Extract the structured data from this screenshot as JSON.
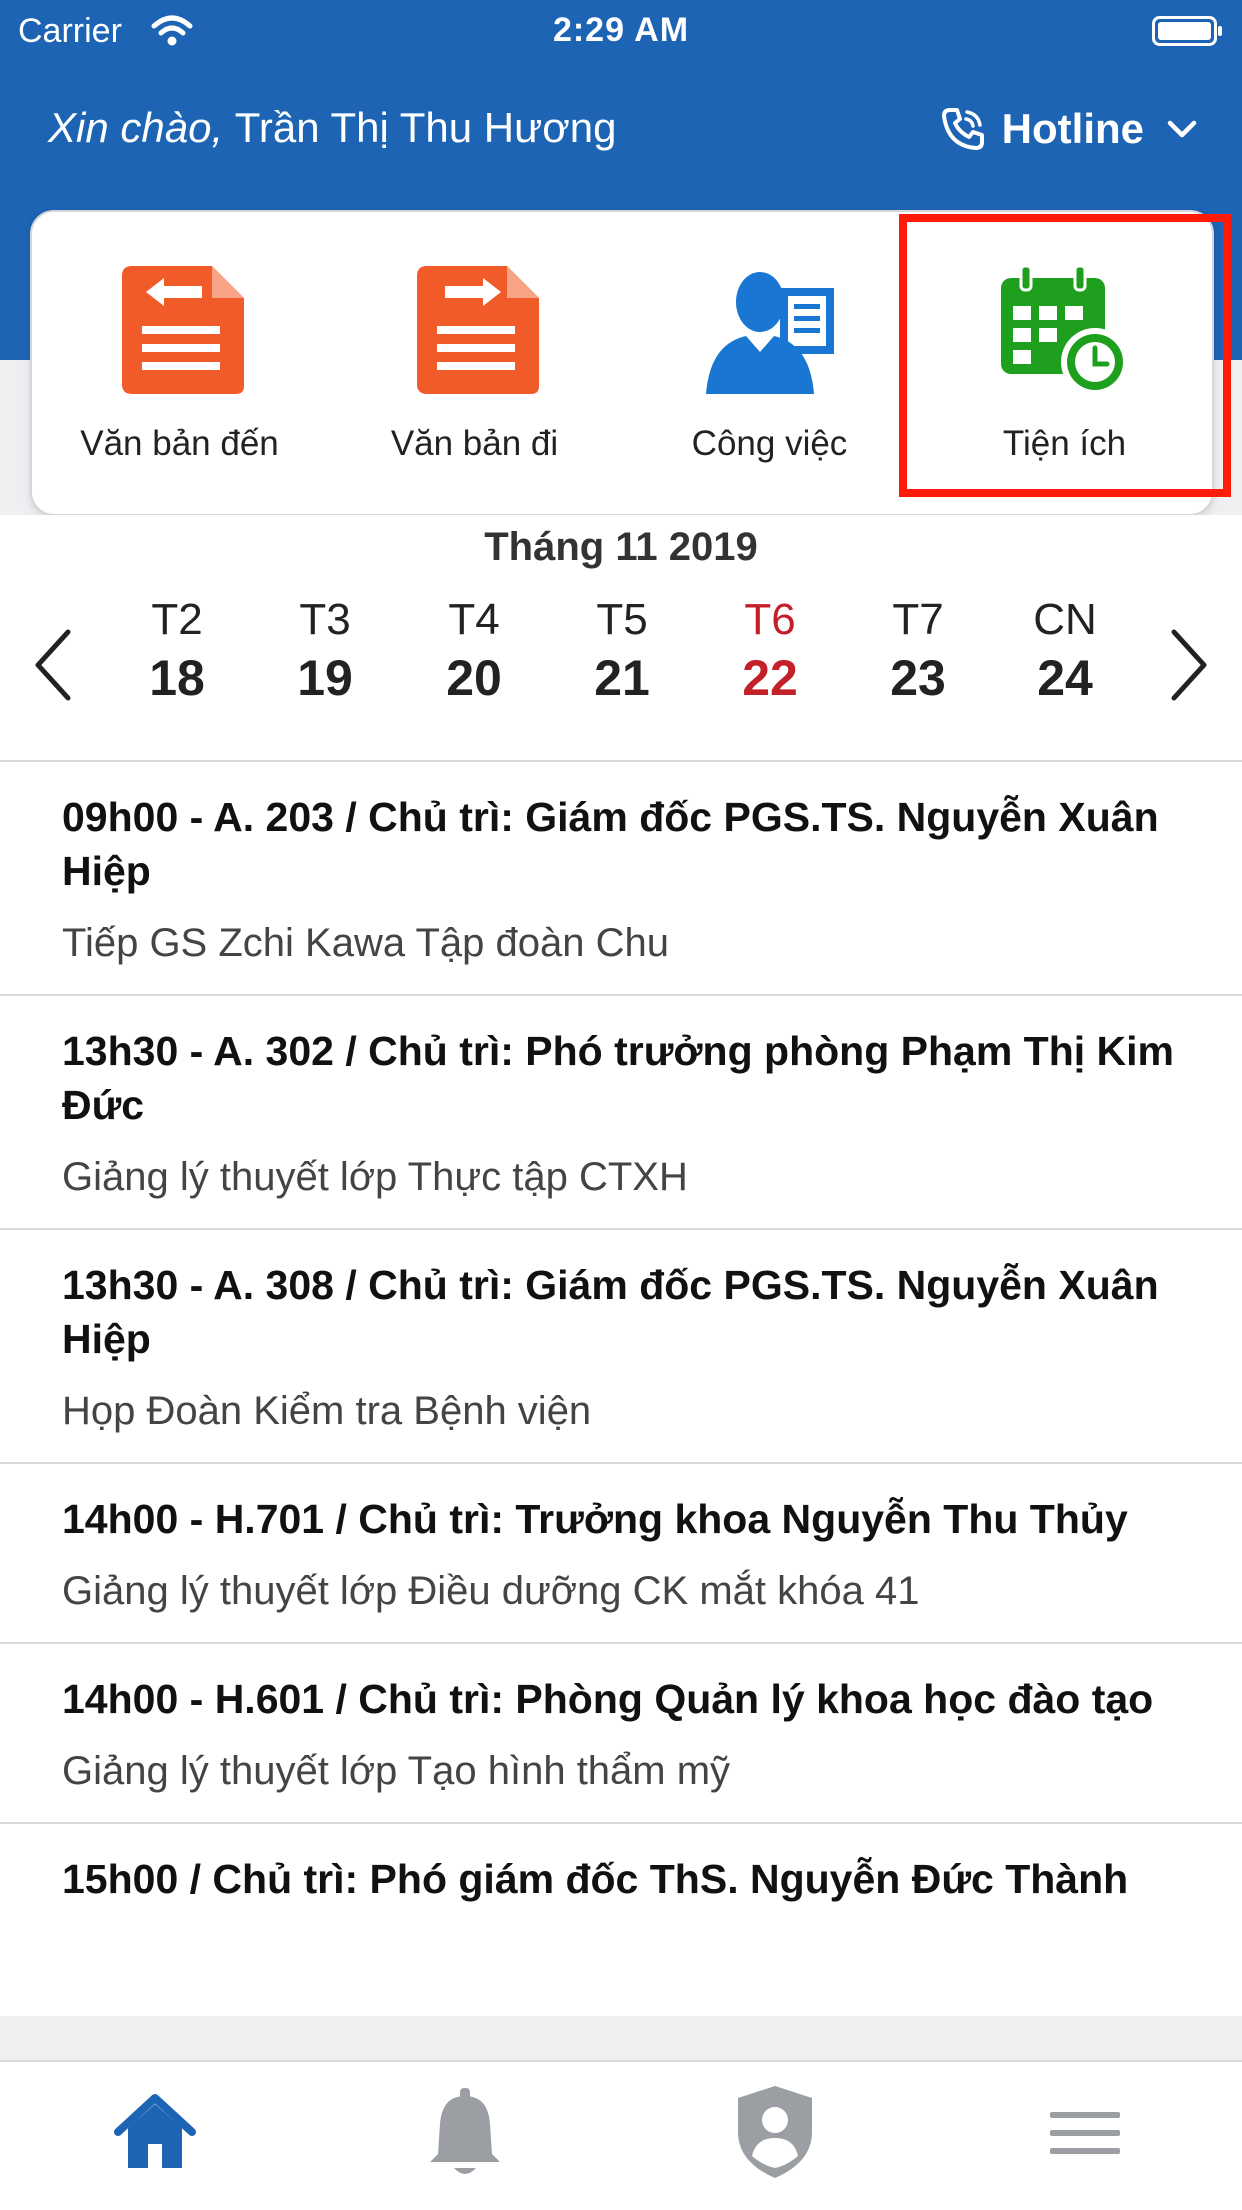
{
  "status_bar": {
    "carrier": "Carrier",
    "time": "2:29 AM"
  },
  "header": {
    "greeting_prefix": "Xin chào,",
    "user_name": "Trần Thị Thu Hương",
    "hotline_label": "Hotline"
  },
  "menu": [
    {
      "label": "Văn bản đến",
      "icon": "incoming-document-icon",
      "color": "#f15a29"
    },
    {
      "label": "Văn bản đi",
      "icon": "outgoing-document-icon",
      "color": "#f15a29"
    },
    {
      "label": "Công việc",
      "icon": "work-person-icon",
      "color": "#1976d2"
    },
    {
      "label": "Tiện ích",
      "icon": "calendar-clock-icon",
      "color": "#1ea01e"
    }
  ],
  "calendar": {
    "month_title": "Tháng 11 2019",
    "days": [
      {
        "name": "T2",
        "num": "18"
      },
      {
        "name": "T3",
        "num": "19"
      },
      {
        "name": "T4",
        "num": "20"
      },
      {
        "name": "T5",
        "num": "21"
      },
      {
        "name": "T6",
        "num": "22",
        "today": true
      },
      {
        "name": "T7",
        "num": "23"
      },
      {
        "name": "CN",
        "num": "24"
      }
    ]
  },
  "events": [
    {
      "title": "09h00 - A. 203 / Chủ trì: Giám đốc PGS.TS. Nguyễn Xuân Hiệp",
      "desc": "Tiếp GS Zchi Kawa Tập đoàn Chu"
    },
    {
      "title": "13h30 - A. 302 / Chủ trì: Phó trưởng phòng Phạm Thị Kim Đức",
      "desc": "Giảng lý thuyết lớp Thực tập CTXH"
    },
    {
      "title": "13h30 - A. 308 / Chủ trì: Giám đốc PGS.TS. Nguyễn Xuân Hiệp",
      "desc": "Họp Đoàn Kiểm tra Bệnh viện"
    },
    {
      "title": "14h00 - H.701 / Chủ trì: Trưởng khoa Nguyễn Thu Thủy",
      "desc": "Giảng lý thuyết lớp Điều dưỡng CK mắt khóa 41"
    },
    {
      "title": "14h00 - H.601 / Chủ trì: Phòng Quản lý khoa học đào tạo",
      "desc": "Giảng lý thuyết lớp Tạo hình thẩm mỹ"
    },
    {
      "title": "15h00 / Chủ trì: Phó giám đốc ThS. Nguyễn Đức Thành",
      "desc": ""
    }
  ],
  "tabbar": {
    "items": [
      {
        "icon": "home-icon",
        "active": true
      },
      {
        "icon": "bell-icon",
        "active": false
      },
      {
        "icon": "shield-user-icon",
        "active": false
      },
      {
        "icon": "menu-icon",
        "active": false
      }
    ],
    "active_color": "#1d64b4",
    "inactive_color": "#9b9ea3"
  },
  "colors": {
    "header_blue": "#1d64b4",
    "highlight_red": "#ff1a0a",
    "today_red": "#c4202a"
  }
}
